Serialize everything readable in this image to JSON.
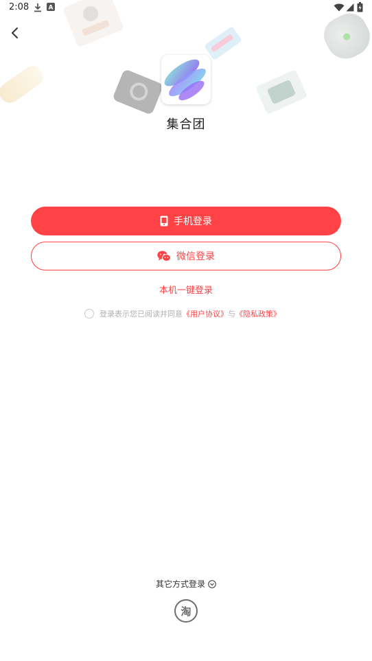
{
  "status_bar": {
    "time": "2:08",
    "icons": [
      "download-icon",
      "notification-a-icon",
      "wifi-icon",
      "signal-icon",
      "battery-icon"
    ]
  },
  "header": {
    "back_icon": "chevron-left-icon"
  },
  "app": {
    "name": "集合团",
    "logo_icon": "swirl-logo-icon"
  },
  "login": {
    "phone_label": "手机登录",
    "phone_icon": "phone-icon",
    "wechat_label": "微信登录",
    "wechat_icon": "wechat-icon",
    "one_click_label": "本机一键登录"
  },
  "agreement": {
    "prefix": "登录表示您已阅读并同意",
    "user_agreement": "《用户协议》",
    "conjunction": "与",
    "privacy_policy": "《隐私政策》"
  },
  "other": {
    "label": "其它方式登录",
    "chevron_icon": "chevron-down-circle-icon",
    "taobao_label": "淘"
  },
  "colors": {
    "accent": "#ff4245",
    "muted": "#b0b0b0",
    "text": "#222222"
  }
}
